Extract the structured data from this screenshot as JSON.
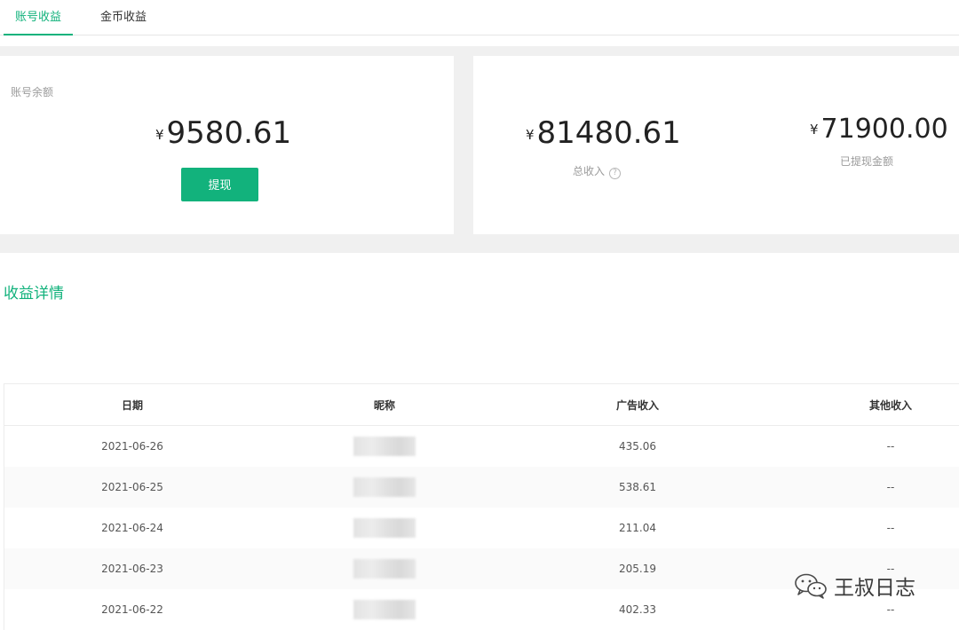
{
  "tabs": [
    {
      "label": "账号收益",
      "active": true
    },
    {
      "label": "金币收益",
      "active": false
    }
  ],
  "balance": {
    "label": "账号余额",
    "currency": "¥",
    "amount": "9580.61",
    "withdraw_button": "提现"
  },
  "income": {
    "total_currency": "¥",
    "total_amount": "81480.61",
    "total_label": "总收入",
    "help_symbol": "?",
    "withdrawn_currency": "¥",
    "withdrawn_amount": "71900.00",
    "withdrawn_label": "已提现金额"
  },
  "details": {
    "title": "收益详情",
    "columns": [
      "日期",
      "昵称",
      "广告收入",
      "其他收入"
    ],
    "rows": [
      {
        "date": "2021-06-26",
        "ad_income": "435.06",
        "other_income": "--"
      },
      {
        "date": "2021-06-25",
        "ad_income": "538.61",
        "other_income": "--"
      },
      {
        "date": "2021-06-24",
        "ad_income": "211.04",
        "other_income": "--"
      },
      {
        "date": "2021-06-23",
        "ad_income": "205.19",
        "other_income": "--"
      },
      {
        "date": "2021-06-22",
        "ad_income": "402.33",
        "other_income": "--"
      }
    ]
  },
  "watermark": {
    "text": "王叔日志",
    "icon": "wechat-icon"
  },
  "colors": {
    "accent": "#12b27c",
    "band": "#f0f0f0",
    "muted_text": "#9b9b9b"
  }
}
